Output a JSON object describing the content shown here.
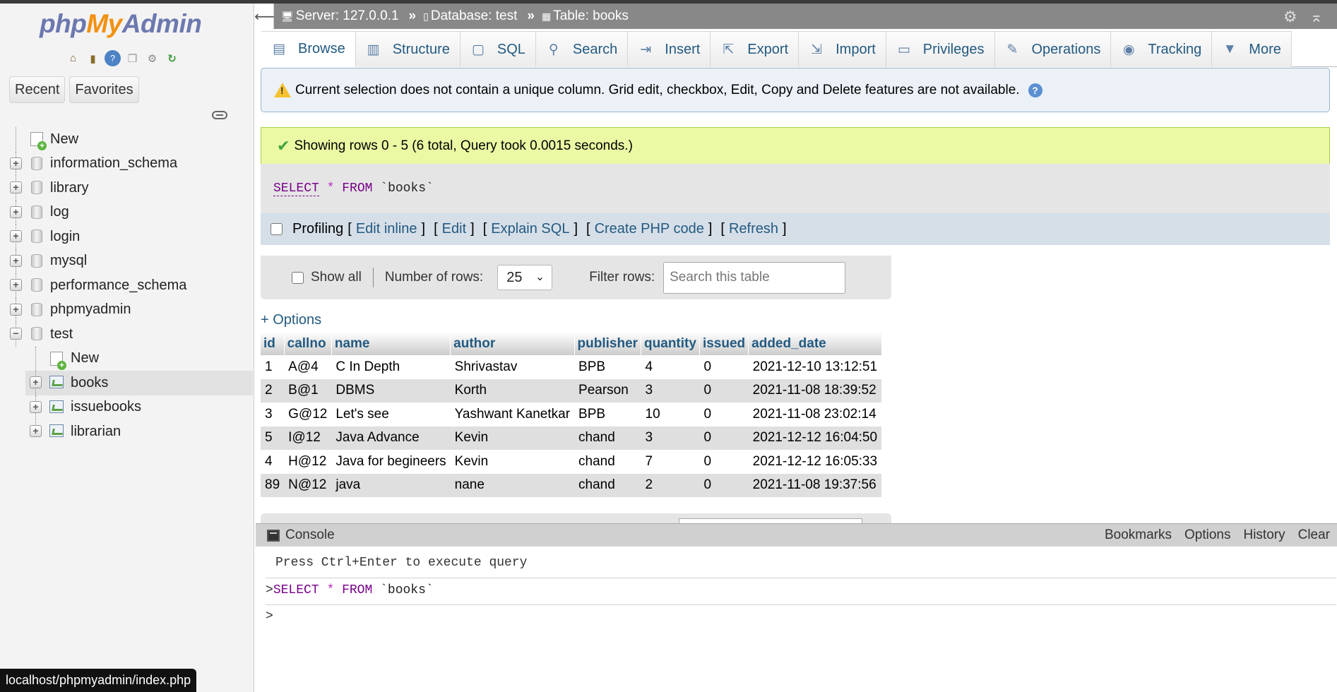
{
  "brand": {
    "php": "php",
    "my": "My",
    "admin": "Admin"
  },
  "nav": {
    "icons": [
      "home-icon",
      "database-icon",
      "help-icon",
      "docs-icon",
      "settings-icon",
      "reload-icon"
    ],
    "tabs": {
      "recent": "Recent",
      "favorites": "Favorites"
    },
    "tree": [
      {
        "label": "New",
        "kind": "new",
        "level": 0
      },
      {
        "label": "information_schema",
        "kind": "db",
        "level": 0
      },
      {
        "label": "library",
        "kind": "db",
        "level": 0
      },
      {
        "label": "log",
        "kind": "db",
        "level": 0
      },
      {
        "label": "login",
        "kind": "db",
        "level": 0
      },
      {
        "label": "mysql",
        "kind": "db",
        "level": 0
      },
      {
        "label": "performance_schema",
        "kind": "db",
        "level": 0
      },
      {
        "label": "phpmyadmin",
        "kind": "db",
        "level": 0
      },
      {
        "label": "test",
        "kind": "db-open",
        "level": 0
      },
      {
        "label": "New",
        "kind": "new",
        "level": 1
      },
      {
        "label": "books",
        "kind": "table",
        "level": 1,
        "selected": true
      },
      {
        "label": "issuebooks",
        "kind": "table",
        "level": 1
      },
      {
        "label": "librarian",
        "kind": "table",
        "level": 1
      }
    ]
  },
  "status_url": "localhost/phpmyadmin/index.php",
  "breadcrumb": {
    "server": "Server: 127.0.0.1",
    "database": "Database: test",
    "table": "Table: books",
    "sep": "»"
  },
  "tabs": [
    {
      "label": "Browse",
      "icon": "▤",
      "name": "tab-browse",
      "active": true
    },
    {
      "label": "Structure",
      "icon": "▥",
      "name": "tab-structure"
    },
    {
      "label": "SQL",
      "icon": "▢",
      "name": "tab-sql"
    },
    {
      "label": "Search",
      "icon": "⚲",
      "name": "tab-search"
    },
    {
      "label": "Insert",
      "icon": "⇥",
      "name": "tab-insert"
    },
    {
      "label": "Export",
      "icon": "⇱",
      "name": "tab-export"
    },
    {
      "label": "Import",
      "icon": "⇲",
      "name": "tab-import"
    },
    {
      "label": "Privileges",
      "icon": "▭",
      "name": "tab-privileges"
    },
    {
      "label": "Operations",
      "icon": "✎",
      "name": "tab-operations"
    },
    {
      "label": "Tracking",
      "icon": "◉",
      "name": "tab-tracking"
    },
    {
      "label": "More",
      "icon": "▼",
      "name": "tab-more"
    }
  ],
  "notice": "Current selection does not contain a unique column. Grid edit, checkbox, Edit, Copy and Delete features are not available.",
  "success": "Showing rows 0 - 5 (6 total, Query took 0.0015 seconds.)",
  "sql": {
    "select": "SELECT",
    "star": "*",
    "from": "FROM",
    "table": "`books`"
  },
  "profiling": {
    "label": "Profiling",
    "links": [
      "Edit inline",
      "Edit",
      "Explain SQL",
      "Create PHP code",
      "Refresh"
    ]
  },
  "controls": {
    "show_all": "Show all",
    "rows_label": "Number of rows:",
    "rows_value": "25",
    "filter_label": "Filter rows:",
    "filter_placeholder": "Search this table"
  },
  "options_link": "+ Options",
  "table": {
    "columns": [
      "id",
      "callno",
      "name",
      "author",
      "publisher",
      "quantity",
      "issued",
      "added_date"
    ],
    "rows": [
      [
        "1",
        "A@4",
        "C In Depth",
        "Shrivastav",
        "BPB",
        "4",
        "0",
        "2021-12-10 13:12:51"
      ],
      [
        "2",
        "B@1",
        "DBMS",
        "Korth",
        "Pearson",
        "3",
        "0",
        "2021-11-08 18:39:52"
      ],
      [
        "3",
        "G@12",
        "Let's see",
        "Yashwant Kanetkar",
        "BPB",
        "10",
        "0",
        "2021-11-08 23:02:14"
      ],
      [
        "5",
        "I@12",
        "Java Advance",
        "Kevin",
        "chand",
        "3",
        "0",
        "2021-12-12 16:04:50"
      ],
      [
        "4",
        "H@12",
        "Java for begineers",
        "Kevin",
        "chand",
        "7",
        "0",
        "2021-12-12 16:05:33"
      ],
      [
        "89",
        "N@12",
        "java",
        "nane",
        "chand",
        "2",
        "0",
        "2021-11-08 19:37:56"
      ]
    ]
  },
  "console": {
    "title": "Console",
    "links": [
      "Bookmarks",
      "Options",
      "History",
      "Clear"
    ],
    "hint": "Press Ctrl+Enter to execute query",
    "prompt": ">"
  }
}
